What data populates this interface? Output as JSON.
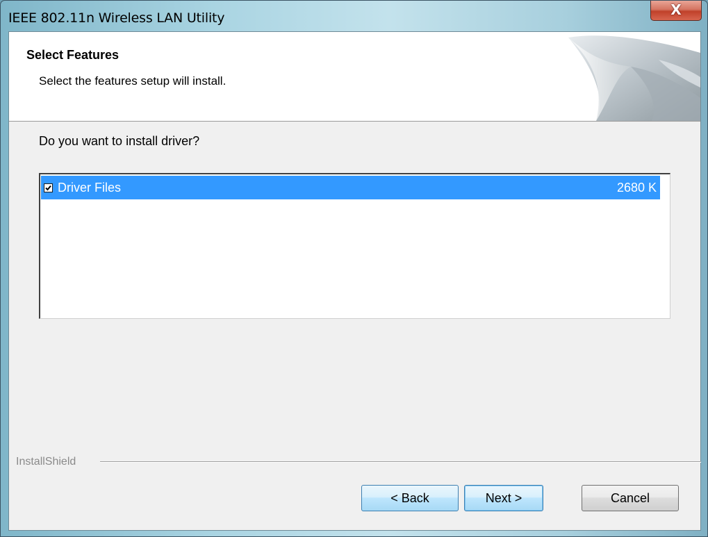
{
  "window": {
    "title": "IEEE 802.11n Wireless LAN Utility",
    "close_label": "X"
  },
  "header": {
    "title": "Select Features",
    "subtitle": "Select the features setup will install."
  },
  "main": {
    "question": "Do you want to install driver?",
    "features": [
      {
        "name": "Driver Files",
        "size": "2680 K",
        "checked": true,
        "selected": true
      }
    ]
  },
  "footer": {
    "brand": "InstallShield",
    "buttons": {
      "back": "< Back",
      "next": "Next >",
      "cancel": "Cancel"
    }
  },
  "colors": {
    "selection": "#3399ff",
    "dialog_bg": "#f0f0f0",
    "close_button": "#c0412a"
  },
  "icons": {
    "close": "close-icon",
    "checkbox": "checkmark-icon",
    "header_art": "page-curl-art"
  }
}
